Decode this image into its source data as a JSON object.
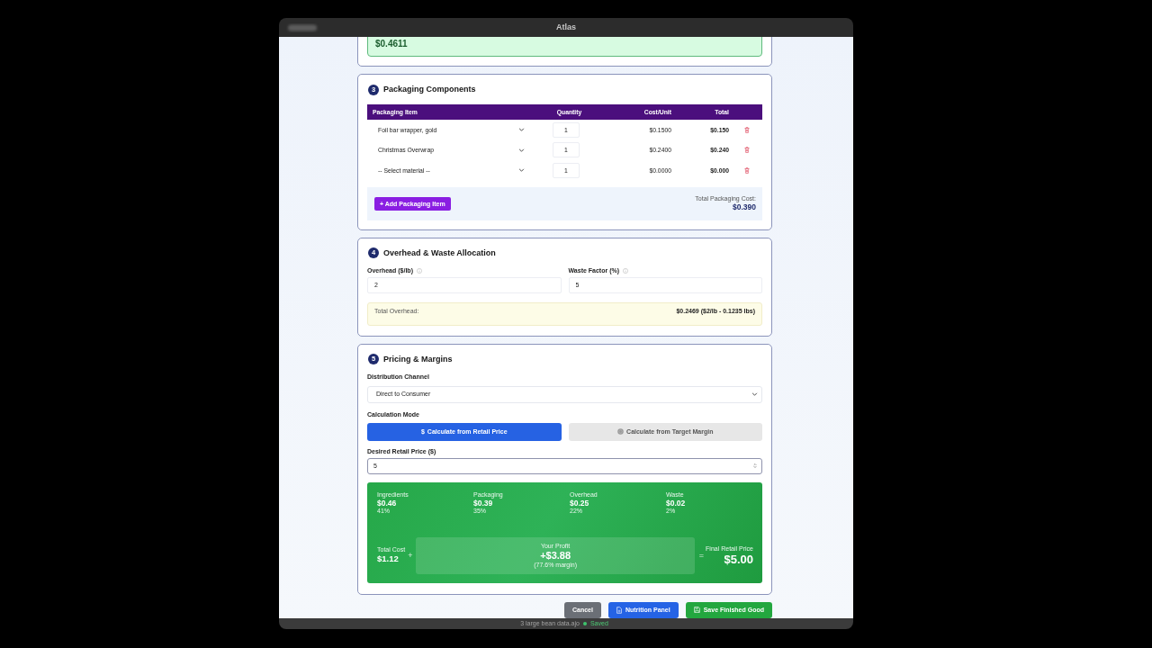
{
  "window": {
    "title": "Atlas"
  },
  "ingredients_total": {
    "value": "$0.4611"
  },
  "packaging": {
    "step": "3",
    "title": "Packaging Components",
    "columns": [
      "Packaging Item",
      "Quantity",
      "Cost/Unit",
      "Total"
    ],
    "rows": [
      {
        "material": "Foil bar wrapper, gold",
        "quantity": "1",
        "cost_per_unit": "$0.1500",
        "total": "$0.150"
      },
      {
        "material": "Christmas Overwrap",
        "quantity": "1",
        "cost_per_unit": "$0.2400",
        "total": "$0.240"
      },
      {
        "material": "-- Select material --",
        "quantity": "1",
        "cost_per_unit": "$0.0000",
        "total": "$0.000"
      }
    ],
    "add_button": "+ Add Packaging Item",
    "total_label": "Total Packaging Cost:",
    "total_value": "$0.390"
  },
  "overhead": {
    "step": "4",
    "title": "Overhead & Waste Allocation",
    "fields": [
      {
        "label": "Overhead ($/lb)",
        "value": "2"
      },
      {
        "label": "Waste Factor (%)",
        "value": "5"
      }
    ],
    "total_label": "Total Overhead:",
    "total_value": "$0.2469 ($2/lb - 0.1235 lbs)"
  },
  "pricing": {
    "step": "5",
    "title": "Pricing & Margins",
    "channel": {
      "label": "Distribution Channel",
      "value": "Direct to Consumer"
    },
    "mode": {
      "label": "Calculation Mode",
      "options": [
        {
          "symbol": "$",
          "label": "Calculate from Retail Price",
          "selected": true
        },
        {
          "label": "Calculate from Target Margin",
          "selected": false
        }
      ]
    },
    "retail_price": {
      "label": "Desired Retail Price ($)",
      "value": "5"
    },
    "breakdown": [
      {
        "label": "Ingredients",
        "value": "$0.46",
        "share": "41%"
      },
      {
        "label": "Packaging",
        "value": "$0.39",
        "share": "35%"
      },
      {
        "label": "Overhead",
        "value": "$0.25",
        "share": "22%"
      },
      {
        "label": "Waste",
        "value": "$0.02",
        "share": "2%"
      }
    ],
    "total_cost": {
      "label": "Total Cost",
      "value": "$1.12"
    },
    "plus": "+",
    "profit": {
      "label": "Your Profit",
      "value": "+$3.88",
      "margin": "(77.6% margin)"
    },
    "equals": "=",
    "final_price": {
      "label": "Final Retail Price",
      "value": "$5.00"
    }
  },
  "actions": [
    {
      "kind": "cancel",
      "label": "Cancel"
    },
    {
      "kind": "panel",
      "label": "Nutrition Panel"
    },
    {
      "kind": "save",
      "label": "Save Finished Good"
    }
  ],
  "status_bar": {
    "text": "3 large bean data.ajo",
    "state": "Saved"
  }
}
